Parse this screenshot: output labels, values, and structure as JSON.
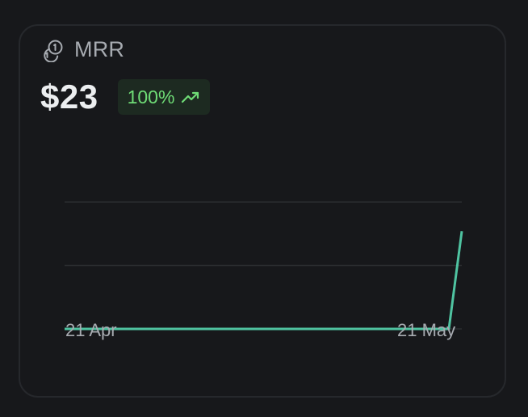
{
  "metric": {
    "label": "MRR",
    "value": "$23",
    "change": "100%",
    "icon": "coins-icon",
    "trend_icon": "trending-up-icon"
  },
  "colors": {
    "background": "#17181b",
    "card_border": "#26282c",
    "line": "#4fc3a1",
    "badge_bg": "#1d2a21",
    "badge_text": "#6fdc76",
    "gridline": "#2a2c30",
    "muted_text": "#a7abb1"
  },
  "chart_data": {
    "type": "line",
    "x": [
      "21 Apr",
      "21 May"
    ],
    "x_start": "21 Apr",
    "x_end": "21 May",
    "series": [
      {
        "values": [
          0,
          0,
          23
        ]
      }
    ],
    "ylim": [
      0,
      23
    ],
    "grid": true
  }
}
